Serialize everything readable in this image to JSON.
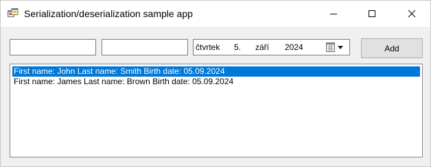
{
  "window": {
    "title": "Serialization/deserialization sample app",
    "icon": "app-window-icon",
    "controls": [
      "minimize-icon",
      "maximize-icon",
      "close-icon"
    ]
  },
  "form": {
    "first_name_value": "",
    "last_name_value": "",
    "date_picker": {
      "day_of_week": "čtvrtek",
      "day": "5.",
      "month": "září",
      "year": "2024",
      "icon": "calendar-dropdown-icon"
    },
    "add_label": "Add"
  },
  "list": {
    "items": [
      {
        "text": "First name: John Last name: Smith Birth date: 05.09.2024",
        "selected": true
      },
      {
        "text": "First name: James Last name: Brown Birth date: 05.09.2024",
        "selected": false
      }
    ],
    "selection_color": "#0078d7"
  }
}
